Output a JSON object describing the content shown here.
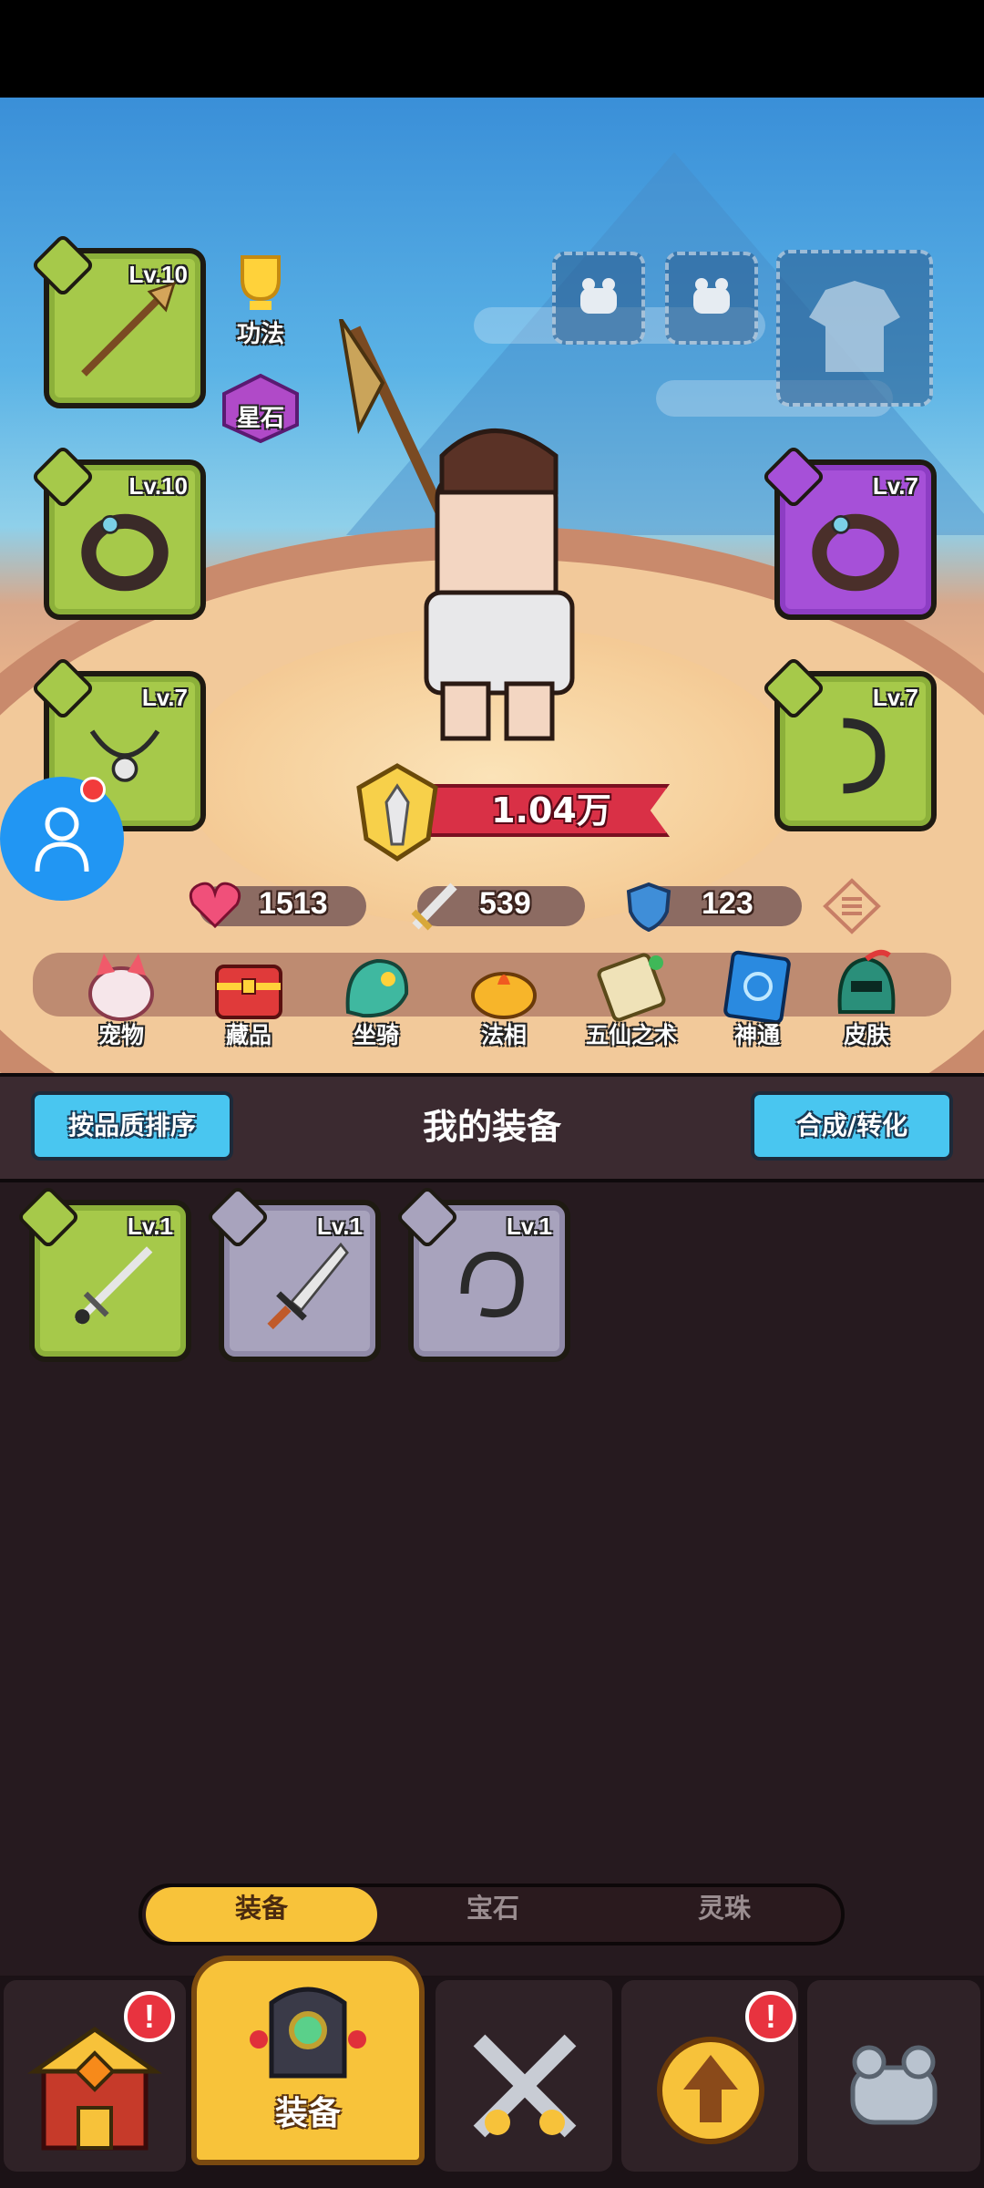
{
  "character": {
    "power": "1.04万",
    "stats": {
      "hp": "1513",
      "attack": "539",
      "defense": "123"
    }
  },
  "side_buttons": {
    "gongfa": "功法",
    "xingshi": "星石"
  },
  "equipped": {
    "weapon": {
      "level": "Lv.10",
      "rarity": "green",
      "icon": "spear-icon"
    },
    "ring_left": {
      "level": "Lv.10",
      "rarity": "green",
      "icon": "ring-icon"
    },
    "necklace": {
      "level": "Lv.7",
      "rarity": "green",
      "icon": "pendant-icon"
    },
    "ring_right": {
      "level": "Lv.7",
      "rarity": "purple",
      "icon": "ring-icon"
    },
    "bracelet": {
      "level": "Lv.7",
      "rarity": "green",
      "icon": "bracelet-icon"
    }
  },
  "menu": [
    {
      "label": "宠物",
      "icon": "pet-icon"
    },
    {
      "label": "藏品",
      "icon": "treasure-chest-icon"
    },
    {
      "label": "坐骑",
      "icon": "mount-icon"
    },
    {
      "label": "法相",
      "icon": "teapot-icon"
    },
    {
      "label": "五仙之术",
      "icon": "scroll-icon"
    },
    {
      "label": "神通",
      "icon": "spellbook-icon"
    },
    {
      "label": "皮肤",
      "icon": "helmet-icon"
    }
  ],
  "inventory": {
    "sort_button": "按品质排序",
    "title": "我的装备",
    "merge_button": "合成/转化",
    "items": [
      {
        "level": "Lv.1",
        "rarity": "green",
        "icon": "sword-icon"
      },
      {
        "level": "Lv.1",
        "rarity": "gray",
        "icon": "dagger-icon"
      },
      {
        "level": "Lv.1",
        "rarity": "gray",
        "icon": "bracelet-icon"
      }
    ]
  },
  "sub_tabs": [
    "装备",
    "宝石",
    "灵珠"
  ],
  "bottom_nav": {
    "active_label": "装备"
  },
  "alert_symbol": "!",
  "colors": {
    "green": "#a6c94a",
    "purple": "#a650d8",
    "gray": "#a8a3bd",
    "accent": "#f8c33a",
    "button_blue": "#49c6f0"
  }
}
